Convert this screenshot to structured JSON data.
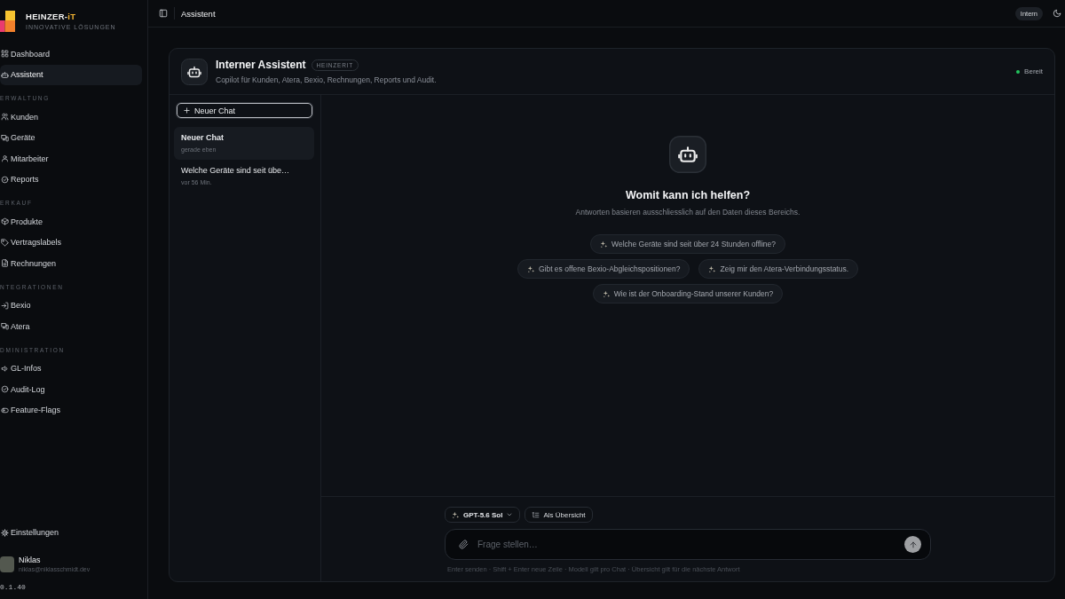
{
  "sidebar": {
    "logo": {
      "brand": "HEINZER-",
      "brand_accent": "iT",
      "tagline": "INNOVATIVE LÖSUNGEN"
    },
    "sections": [
      {
        "items": [
          {
            "label": "Dashboard",
            "selected": false
          },
          {
            "label": "Assistent",
            "selected": true
          }
        ]
      },
      {
        "label": "ERWALTUNG",
        "items": [
          {
            "label": "Kunden",
            "selected": false
          },
          {
            "label": "Geräte",
            "selected": false
          },
          {
            "label": "Mitarbeiter",
            "selected": false
          },
          {
            "label": "Reports",
            "selected": false
          }
        ]
      },
      {
        "label": "ERKAUF",
        "items": [
          {
            "label": "Produkte",
            "selected": false
          },
          {
            "label": "Vertragslabels",
            "selected": false
          },
          {
            "label": "Rechnungen",
            "selected": false
          }
        ]
      },
      {
        "label": "NTEGRATIONEN",
        "items": [
          {
            "label": "Bexio",
            "selected": false
          },
          {
            "label": "Atera",
            "selected": false
          }
        ]
      },
      {
        "label": "DMINISTRATION",
        "items": [
          {
            "label": "GL-Infos",
            "selected": false
          },
          {
            "label": "Audit-Log",
            "selected": false
          },
          {
            "label": "Feature-Flags",
            "selected": false
          }
        ]
      }
    ],
    "settings": {
      "label": "Einstellungen"
    },
    "user": {
      "name": "Niklas",
      "email": "niklas@niklasschmidt.dev"
    },
    "version": "0.1.40"
  },
  "topbar": {
    "title": "Assistent",
    "badge": "Intern"
  },
  "assistant": {
    "title": "Interner Assistent",
    "badge": "HEINZERIT",
    "subtitle": "Copilot für Kunden, Atera, Bexio, Rechnungen, Reports und Audit.",
    "status": {
      "label": "Bereit",
      "ready": true
    }
  },
  "chats": {
    "new_button": "Neuer Chat",
    "items": [
      {
        "title": "Neuer Chat",
        "time": "gerade eben",
        "selected": true
      },
      {
        "title": "Welche Geräte sind seit übe…",
        "time": "vor 56 Min.",
        "selected": false
      }
    ]
  },
  "empty_state": {
    "heading": "Womit kann ich helfen?",
    "subtitle": "Antworten basieren ausschliesslich auf den Daten dieses Bereichs.",
    "suggestion_rows": [
      [
        "Welche Geräte sind seit über 24 Stunden offline?"
      ],
      [
        "Gibt es offene Bexio-Abgleichspositionen?",
        "Zeig mir den Atera-Verbindungsstatus."
      ],
      [
        "Wie ist der Onboarding-Stand unserer Kunden?"
      ]
    ]
  },
  "composer": {
    "model": "GPT-5.6 Sol",
    "view_toggle": "Als Übersicht",
    "placeholder": "Frage stellen…",
    "hint": "Enter senden · Shift + Enter neue Zeile · Modell gilt pro Chat · Übersicht gilt für die nächste Antwort"
  }
}
